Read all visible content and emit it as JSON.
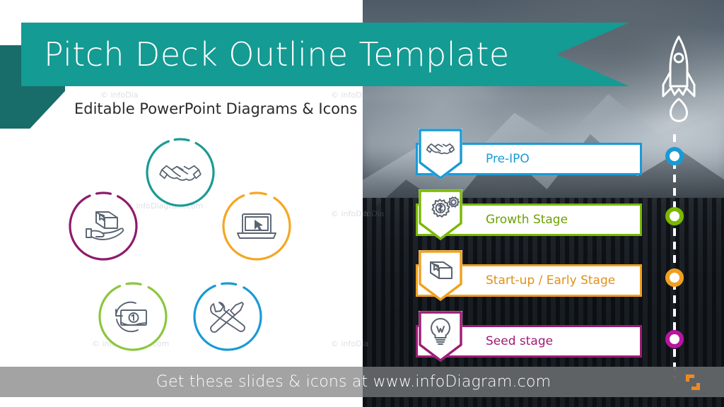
{
  "slide": {
    "title": "Pitch Deck Outline Template",
    "subtitle": "Editable PowerPoint Diagrams & Icons",
    "accent_teal": "#149b93",
    "accent_teal_dark": "#186c6a"
  },
  "footer": {
    "text": "Get these slides & icons at www.infoDiagram.com",
    "logo_name": "infodiagram-logo",
    "logo_color": "#f08a1e",
    "bar_color": "#969696"
  },
  "watermark": {
    "text": "© infoDiagram.com",
    "short": "© infoDia"
  },
  "cycle_diagram": {
    "name": "five-step-cycle-diagram",
    "nodes": [
      {
        "icon": "handshake-icon",
        "color": "#1a9b93",
        "position": "top"
      },
      {
        "icon": "laptop-cursor-icon",
        "color": "#f5a623",
        "position": "right"
      },
      {
        "icon": "tools-icon",
        "color": "#199ad6",
        "position": "bottom-right"
      },
      {
        "icon": "money-return-icon",
        "color": "#8cc63f",
        "position": "bottom-left"
      },
      {
        "icon": "package-hand-icon",
        "color": "#8e1b6b",
        "position": "left"
      }
    ],
    "connector_color": "#a7adb5",
    "icon_stroke": "#5a6472"
  },
  "stages": {
    "name": "funding-stage-list",
    "items": [
      {
        "label": "Pre-IPO",
        "color": "#199ad6",
        "icon": "handshake-icon",
        "icon_name": "stage-icon-pre-ipo"
      },
      {
        "label": "Growth Stage",
        "color": "#7ab800",
        "icon": "gears-dollar-icon",
        "icon_name": "stage-icon-growth"
      },
      {
        "label": "Start-up / Early Stage",
        "color": "#f0a01e",
        "icon": "package-box-icon",
        "icon_name": "stage-icon-startup"
      },
      {
        "label": "Seed stage",
        "color": "#9c1d75",
        "icon": "lightbulb-icon",
        "icon_name": "stage-icon-seed"
      }
    ]
  },
  "timeline": {
    "name": "growth-timeline",
    "rocket_icon": "rocket-icon",
    "line_style": "dashed-white",
    "dots": [
      {
        "color": "#199ad6",
        "label_ref": "Pre-IPO"
      },
      {
        "color": "#7ab800",
        "label_ref": "Growth Stage"
      },
      {
        "color": "#f0a01e",
        "label_ref": "Start-up / Early Stage"
      },
      {
        "color": "#b5179e",
        "label_ref": "Seed stage"
      }
    ]
  }
}
